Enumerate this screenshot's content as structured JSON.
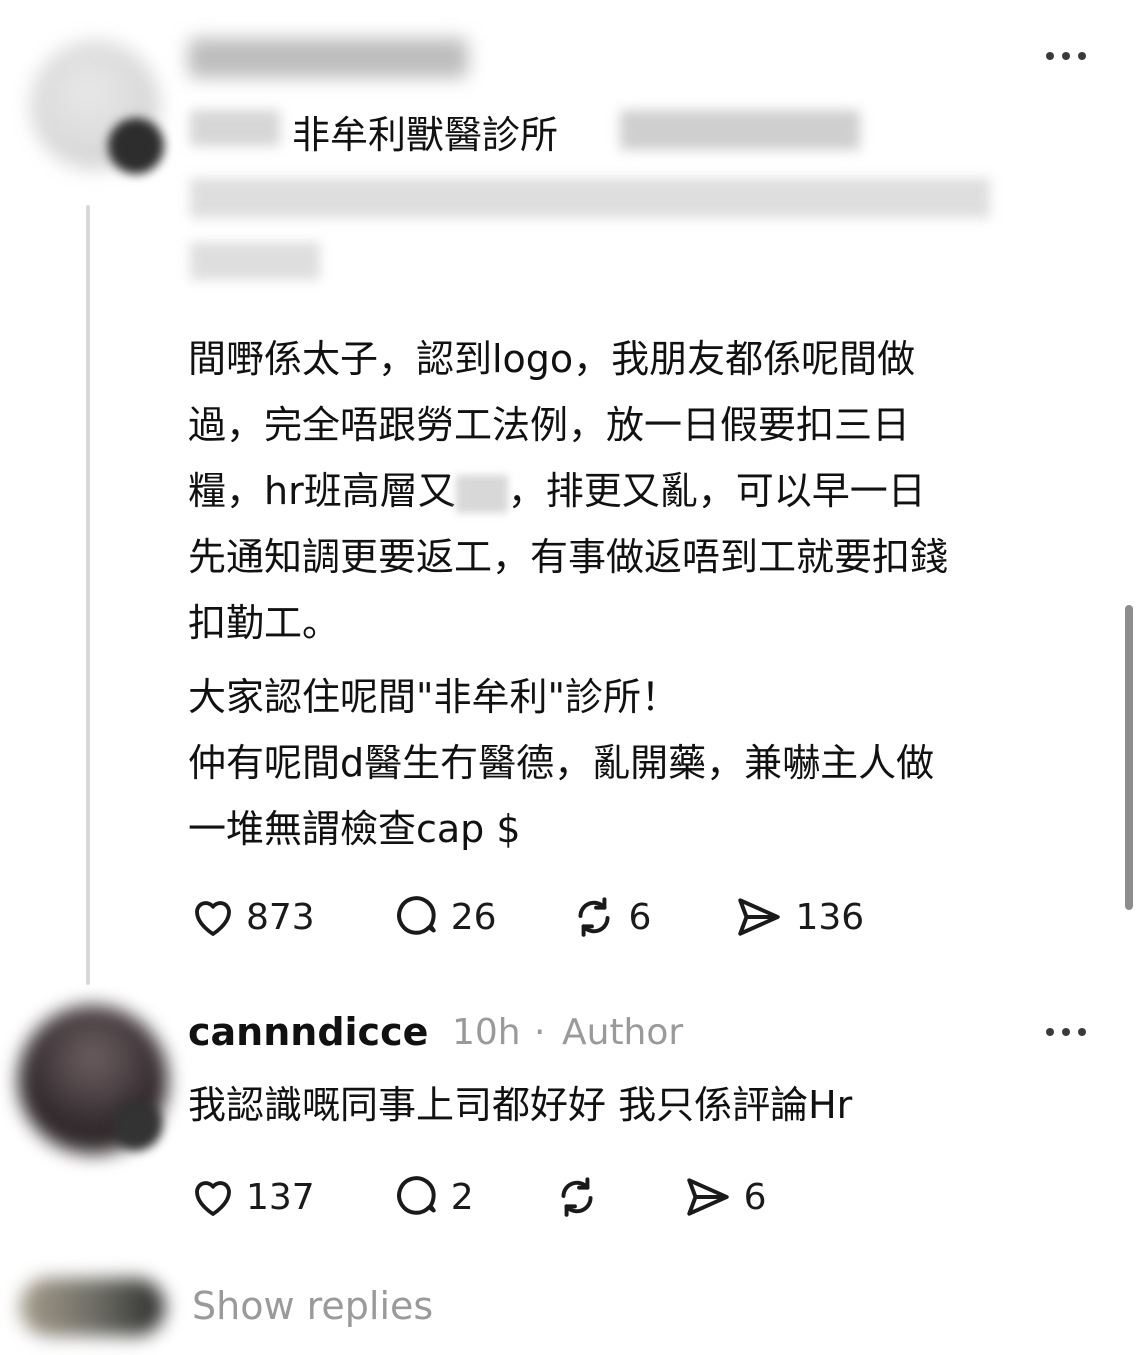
{
  "post": {
    "clinic_label": "非牟利獸醫診所",
    "body_lines": [
      "間嘢係太子，認到logo，我朋友都係呢間做",
      "過，完全唔跟勞工法例，放一日假要扣三日",
      "糧，hr班高層又",
      "，排更又亂，可以早一日",
      "先通知調更要返工，有事做返唔到工就要扣錢",
      "扣勤工。",
      "大家認住呢間\"非牟利\"診所！",
      "仲有呢間d醫生冇醫德，亂開藥，兼嚇主人做",
      "一堆無謂檢查cap $"
    ],
    "actions": {
      "likes": "873",
      "comments": "26",
      "reposts": "6",
      "shares": "136"
    }
  },
  "reply": {
    "username": "cannndicce",
    "time": "10h",
    "separator": "·",
    "role": "Author",
    "text": "我認識嘅同事上司都好好 我只係評論Hr",
    "actions": {
      "likes": "137",
      "comments": "2",
      "shares": "6"
    }
  },
  "show_replies": "Show replies",
  "icons": [
    "heart-icon",
    "comment-icon",
    "repost-icon",
    "share-icon",
    "more-icon"
  ]
}
